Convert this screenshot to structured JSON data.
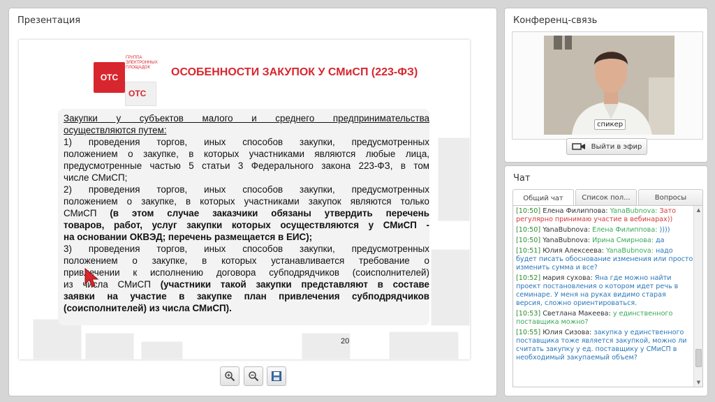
{
  "presentation": {
    "panel_title": "Презентация",
    "slide": {
      "logo_red_text": "OTC",
      "logo_white_text": "OTC",
      "logo_caption": "Группа\nэлектронных\nплощадок",
      "title": "ОСОБЕННОСТИ ЗАКУПОК У СМиСП (223-ФЗ)",
      "page_number": "20",
      "para1_l1": "Закупки у субъектов малого и среднего предпринимательства",
      "para1_l2": "осуществляются путем:",
      "p1_l1": "1) проведения торгов, иных способов закупки, предусмотренных",
      "p1_l2": "положением о закупке, в которых участниками являются любые лица,",
      "p1_l3": "предусмотренные частью 5 статьи 3 Федерального закона 223-ФЗ, в том",
      "p1_l4": "числе СМиСП;",
      "p2_l1": "2) проведения торгов, иных способов закупки, предусмотренных",
      "p2_l2": "положением о закупке, в которых участниками закупок являются только",
      "p2_l3a": "СМиСП",
      "p2_l3b": "(в этом случае заказчики обязаны утвердить перечень",
      "p2_l4": "товаров, работ, услуг закупки которых осуществляются у СМиСП -",
      "p2_l5": "на основании ОКВЭД; перечень размещается в ЕИС);",
      "p3_l1": "3) проведения торгов, иных способов закупки, предусмотренных",
      "p3_l2": "положением о закупке, в которых устанавливается требование о",
      "p3_l3": "привлечении к исполнению договора субподрядчиков (соисполнителей)",
      "p3_l4a": "из числа СМиСП",
      "p3_l4b": "(участники такой закупки представляют в составе",
      "p3_l5": "заявки на участие в закупке план привлечения субподрядчиков",
      "p3_l6": "(соисполнителей) из числа СМиСП)."
    },
    "toolbar": {
      "zoom_in_icon": "zoom-in-icon",
      "zoom_out_icon": "zoom-out-icon",
      "save_icon": "save-icon"
    }
  },
  "conference": {
    "panel_title": "Конференц-связь",
    "speaker_label": "спикер",
    "go_live_label": "Выйти в эфир",
    "camera_icon": "camera-icon"
  },
  "chat": {
    "panel_title": "Чат",
    "tabs": [
      {
        "label": "Общий чат"
      },
      {
        "label": "Список пол..."
      },
      {
        "label": "Вопросы"
      }
    ],
    "messages": [
      {
        "time": "[10:50]",
        "author": "Елена Филиппова:",
        "to": "YanaBubnova:",
        "text": "Зато регулярно принимаю участие в вебинарах))",
        "style": "red"
      },
      {
        "time": "[10:50]",
        "author": "YanaBubnova:",
        "to": "Елена Филиппова:",
        "text": "))))",
        "style": "blue"
      },
      {
        "time": "[10:50]",
        "author": "YanaBubnova:",
        "to": "Ирина Смирнова:",
        "text": "да",
        "style": "blue"
      },
      {
        "time": "[10:51]",
        "author": "Юлия Алексеева:",
        "to": "YanaBubnova:",
        "text": "надо будет писать обоснование изменения или просто изменить сумма и все?",
        "style": "blue"
      },
      {
        "time": "[10:52]",
        "author": "мария сухова:",
        "to": "",
        "text": "Яна где можно найти проект постановления о котором идет речь в семинаре. У меня на руках видимо старая версия, сложно ориентироваться.",
        "style": "blue"
      },
      {
        "time": "[10:53]",
        "author": "Светлана Макеева:",
        "to": "",
        "text": "у единственного поставщика можно?",
        "style": "green"
      },
      {
        "time": "[10:55]",
        "author": "Юлия Сизова:",
        "to": "",
        "text": "закупка у единственного поставщика тоже является закупкой, можно ли считать закупку у ед. поставщику у СМиСП в необходимый закупаемый объем?",
        "style": "blue"
      }
    ]
  },
  "colors": {
    "accent_red": "#d8262e",
    "time_green": "#2e8b2e",
    "link_blue": "#2a77b8"
  }
}
